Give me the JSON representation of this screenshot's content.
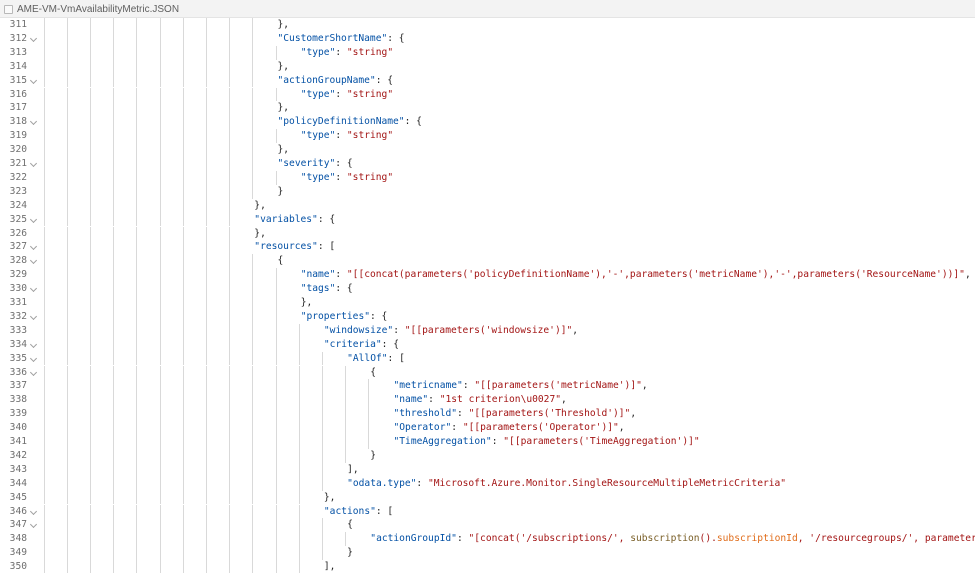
{
  "tab": {
    "title": "AME-VM-VmAvailabilityMetric.JSON"
  },
  "lines": [
    {
      "n": "311",
      "i": 10,
      "fold": false,
      "t": [
        [
          "p",
          "},"
        ]
      ]
    },
    {
      "n": "312",
      "i": 10,
      "fold": true,
      "t": [
        [
          "k",
          "\"CustomerShortName\""
        ],
        [
          "p",
          ": {"
        ]
      ]
    },
    {
      "n": "313",
      "i": 11,
      "fold": false,
      "t": [
        [
          "k",
          "\"type\""
        ],
        [
          "p",
          ": "
        ],
        [
          "s",
          "\"string\""
        ]
      ]
    },
    {
      "n": "314",
      "i": 10,
      "fold": false,
      "t": [
        [
          "p",
          "},"
        ]
      ]
    },
    {
      "n": "315",
      "i": 10,
      "fold": true,
      "t": [
        [
          "k",
          "\"actionGroupName\""
        ],
        [
          "p",
          ": {"
        ]
      ]
    },
    {
      "n": "316",
      "i": 11,
      "fold": false,
      "t": [
        [
          "k",
          "\"type\""
        ],
        [
          "p",
          ": "
        ],
        [
          "s",
          "\"string\""
        ]
      ]
    },
    {
      "n": "317",
      "i": 10,
      "fold": false,
      "t": [
        [
          "p",
          "},"
        ]
      ]
    },
    {
      "n": "318",
      "i": 10,
      "fold": true,
      "t": [
        [
          "k",
          "\"policyDefinitionName\""
        ],
        [
          "p",
          ": {"
        ]
      ]
    },
    {
      "n": "319",
      "i": 11,
      "fold": false,
      "t": [
        [
          "k",
          "\"type\""
        ],
        [
          "p",
          ": "
        ],
        [
          "s",
          "\"string\""
        ]
      ]
    },
    {
      "n": "320",
      "i": 10,
      "fold": false,
      "t": [
        [
          "p",
          "},"
        ]
      ]
    },
    {
      "n": "321",
      "i": 10,
      "fold": true,
      "t": [
        [
          "k",
          "\"severity\""
        ],
        [
          "p",
          ": {"
        ]
      ]
    },
    {
      "n": "322",
      "i": 11,
      "fold": false,
      "t": [
        [
          "k",
          "\"type\""
        ],
        [
          "p",
          ": "
        ],
        [
          "s",
          "\"string\""
        ]
      ]
    },
    {
      "n": "323",
      "i": 10,
      "fold": false,
      "t": [
        [
          "p",
          "}"
        ]
      ]
    },
    {
      "n": "324",
      "i": 9,
      "fold": false,
      "t": [
        [
          "p",
          "},"
        ]
      ]
    },
    {
      "n": "325",
      "i": 9,
      "fold": true,
      "t": [
        [
          "k",
          "\"variables\""
        ],
        [
          "p",
          ": {"
        ]
      ]
    },
    {
      "n": "326",
      "i": 9,
      "fold": false,
      "t": [
        [
          "p",
          "},"
        ]
      ]
    },
    {
      "n": "327",
      "i": 9,
      "fold": true,
      "t": [
        [
          "k",
          "\"resources\""
        ],
        [
          "p",
          ": ["
        ]
      ]
    },
    {
      "n": "328",
      "i": 10,
      "fold": true,
      "t": [
        [
          "p",
          "{"
        ]
      ]
    },
    {
      "n": "329",
      "i": 11,
      "fold": false,
      "t": [
        [
          "k",
          "\"name\""
        ],
        [
          "p",
          ": "
        ],
        [
          "s",
          "\"[[concat(parameters('policyDefinitionName'),'-',parameters('metricName'),'-',parameters('ResourceName'))]\""
        ],
        [
          "p",
          ","
        ]
      ]
    },
    {
      "n": "330",
      "i": 11,
      "fold": true,
      "t": [
        [
          "k",
          "\"tags\""
        ],
        [
          "p",
          ": {"
        ]
      ]
    },
    {
      "n": "331",
      "i": 11,
      "fold": false,
      "t": [
        [
          "p",
          "},"
        ]
      ]
    },
    {
      "n": "332",
      "i": 11,
      "fold": true,
      "t": [
        [
          "k",
          "\"properties\""
        ],
        [
          "p",
          ": {"
        ]
      ]
    },
    {
      "n": "333",
      "i": 12,
      "fold": false,
      "t": [
        [
          "k",
          "\"windowsize\""
        ],
        [
          "p",
          ": "
        ],
        [
          "s",
          "\"[[parameters('windowsize')]\""
        ],
        [
          "p",
          ","
        ]
      ]
    },
    {
      "n": "334",
      "i": 12,
      "fold": true,
      "t": [
        [
          "k",
          "\"criteria\""
        ],
        [
          "p",
          ": {"
        ]
      ]
    },
    {
      "n": "335",
      "i": 13,
      "fold": true,
      "t": [
        [
          "k",
          "\"AllOf\""
        ],
        [
          "p",
          ": ["
        ]
      ]
    },
    {
      "n": "336",
      "i": 14,
      "fold": true,
      "t": [
        [
          "p",
          "{"
        ]
      ]
    },
    {
      "n": "337",
      "i": 15,
      "fold": false,
      "t": [
        [
          "k",
          "\"metricname\""
        ],
        [
          "p",
          ": "
        ],
        [
          "s",
          "\"[[parameters('metricName')]\""
        ],
        [
          "p",
          ","
        ]
      ]
    },
    {
      "n": "338",
      "i": 15,
      "fold": false,
      "t": [
        [
          "k",
          "\"name\""
        ],
        [
          "p",
          ": "
        ],
        [
          "s",
          "\"1st criterion\\u0027\""
        ],
        [
          "p",
          ","
        ]
      ]
    },
    {
      "n": "339",
      "i": 15,
      "fold": false,
      "t": [
        [
          "k",
          "\"threshold\""
        ],
        [
          "p",
          ": "
        ],
        [
          "s",
          "\"[[parameters('Threshold')]\""
        ],
        [
          "p",
          ","
        ]
      ]
    },
    {
      "n": "340",
      "i": 15,
      "fold": false,
      "t": [
        [
          "k",
          "\"Operator\""
        ],
        [
          "p",
          ": "
        ],
        [
          "s",
          "\"[[parameters('Operator')]\""
        ],
        [
          "p",
          ","
        ]
      ]
    },
    {
      "n": "341",
      "i": 15,
      "fold": false,
      "t": [
        [
          "k",
          "\"TimeAggregation\""
        ],
        [
          "p",
          ": "
        ],
        [
          "s",
          "\"[[parameters('TimeAggregation')]\""
        ]
      ]
    },
    {
      "n": "342",
      "i": 14,
      "fold": false,
      "t": [
        [
          "p",
          "}"
        ]
      ]
    },
    {
      "n": "343",
      "i": 13,
      "fold": false,
      "t": [
        [
          "p",
          "],"
        ]
      ]
    },
    {
      "n": "344",
      "i": 13,
      "fold": false,
      "t": [
        [
          "k",
          "\"odata.type\""
        ],
        [
          "p",
          ": "
        ],
        [
          "s",
          "\"Microsoft.Azure.Monitor.SingleResourceMultipleMetricCriteria\""
        ]
      ]
    },
    {
      "n": "345",
      "i": 12,
      "fold": false,
      "t": [
        [
          "p",
          "},"
        ]
      ]
    },
    {
      "n": "346",
      "i": 12,
      "fold": true,
      "t": [
        [
          "k",
          "\"actions\""
        ],
        [
          "p",
          ": ["
        ]
      ]
    },
    {
      "n": "347",
      "i": 13,
      "fold": true,
      "t": [
        [
          "p",
          "{"
        ]
      ]
    },
    {
      "n": "348",
      "i": 14,
      "fold": false,
      "t": [
        [
          "k",
          "\"actionGroupId\""
        ],
        [
          "p",
          ": "
        ],
        [
          "s",
          "\"[concat('/subscriptions/', "
        ],
        [
          "f",
          "subscription"
        ],
        [
          "s",
          "()."
        ],
        [
          "v",
          "subscriptionId"
        ],
        [
          "s",
          ", '/resourcegroups/', parameters"
        ]
      ]
    },
    {
      "n": "349",
      "i": 13,
      "fold": false,
      "t": [
        [
          "p",
          "}"
        ]
      ]
    },
    {
      "n": "350",
      "i": 12,
      "fold": false,
      "t": [
        [
          "p",
          "],"
        ]
      ]
    }
  ]
}
